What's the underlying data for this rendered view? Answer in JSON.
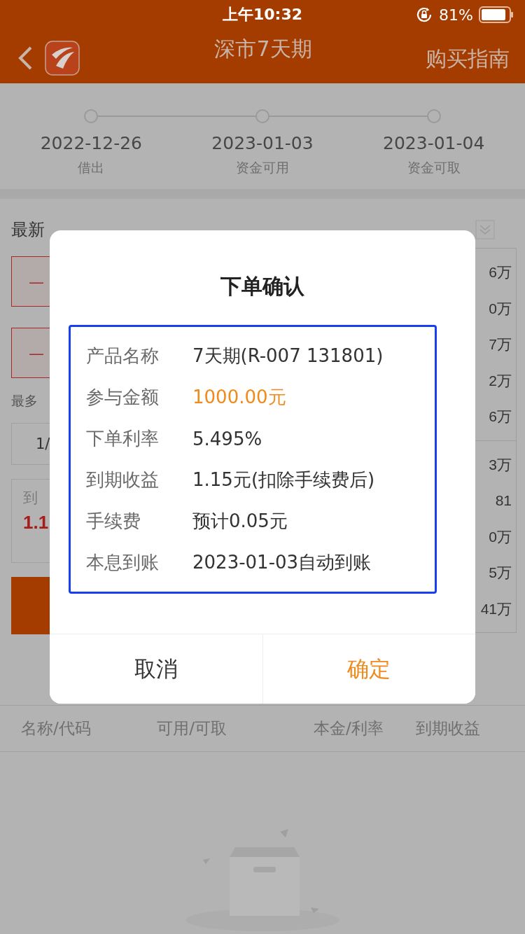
{
  "status_bar": {
    "time": "上午10:32",
    "battery": "81%"
  },
  "nav": {
    "title": "深市7天期",
    "action": "购买指南"
  },
  "timeline": [
    {
      "date": "2022-12-26",
      "label": "借出"
    },
    {
      "date": "2023-01-03",
      "label": "资金可用"
    },
    {
      "date": "2023-01-04",
      "label": "资金可取"
    }
  ],
  "order_form": {
    "heading": "最新",
    "rate_buttons": [
      "—",
      "—"
    ],
    "max_hint": "最多",
    "quantity": "1/",
    "income_label": "到",
    "income_value": "1.1"
  },
  "quote_column": {
    "upper": [
      "6万",
      "0万",
      "7万",
      "2万",
      "6万"
    ],
    "lower": [
      "3万",
      "81",
      "0万",
      "5万",
      "41万"
    ]
  },
  "holdings_columns": [
    "名称/代码",
    "可用/可取",
    "本金/利率",
    "到期收益"
  ],
  "dialog": {
    "title": "下单确认",
    "rows": [
      {
        "label": "产品名称",
        "value": "7天期(R-007 131801)",
        "highlight": false
      },
      {
        "label": "参与金额",
        "value": "1000.00元",
        "highlight": true
      },
      {
        "label": "下单利率",
        "value": "5.495%",
        "highlight": false
      },
      {
        "label": "到期收益",
        "value": "1.15元(扣除手续费后)",
        "highlight": false
      },
      {
        "label": "手续费",
        "value": "预计0.05元",
        "highlight": false
      },
      {
        "label": "本息到账",
        "value": "2023-01-03自动到账",
        "highlight": false
      }
    ],
    "buttons": [
      {
        "label": "取消",
        "primary": false
      },
      {
        "label": "确定",
        "primary": true
      }
    ]
  }
}
